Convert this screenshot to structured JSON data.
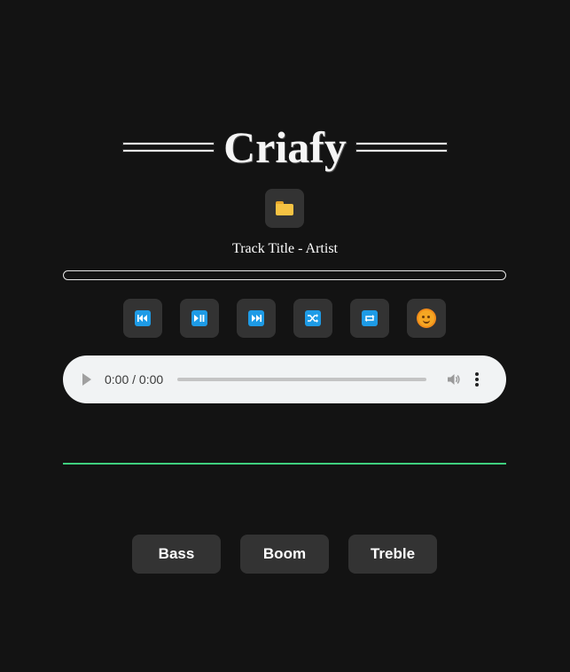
{
  "app": {
    "title": "Criafy"
  },
  "track": {
    "info": "Track Title - Artist",
    "progress": 0
  },
  "controls": [
    {
      "icon": "previous-track-icon"
    },
    {
      "icon": "play-pause-icon"
    },
    {
      "icon": "next-track-icon"
    },
    {
      "icon": "shuffle-icon"
    },
    {
      "icon": "repeat-icon"
    },
    {
      "icon": "sun-face-icon"
    }
  ],
  "audio": {
    "time": "0:00 / 0:00"
  },
  "visualizer": {
    "color": "#3fcf7e"
  },
  "effects": {
    "bass": "Bass",
    "boom": "Boom",
    "treble": "Treble"
  },
  "colors": {
    "background": "#131313",
    "button": "#333333",
    "accent": "#1e9be6"
  }
}
